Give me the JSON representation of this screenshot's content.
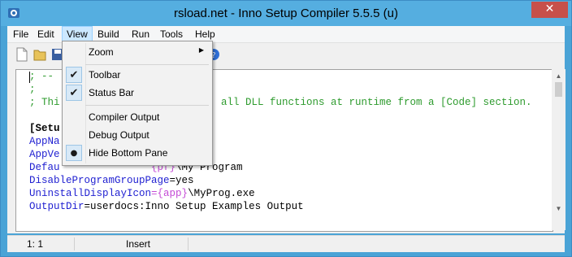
{
  "window": {
    "title": "rsload.net - Inno Setup Compiler 5.5.5 (u)",
    "close_glyph": "✕"
  },
  "menu": [
    "File",
    "Edit",
    "View",
    "Build",
    "Run",
    "Tools",
    "Help"
  ],
  "view_menu": {
    "zoom": "Zoom",
    "toolbar": "Toolbar",
    "status_bar": "Status Bar",
    "compiler_output": "Compiler Output",
    "debug_output": "Debug Output",
    "hide_bottom_pane": "Hide Bottom Pane",
    "check_glyph": "✔",
    "radio_glyph": "●",
    "submenu_glyph": "▶"
  },
  "editor": {
    "lines": [
      {
        "comment": "; --"
      },
      {
        "comment": ";"
      },
      {
        "comment_pre": "; Thi",
        "comment_post": "all DLL functions at runtime from a [Code] section."
      },
      {
        "section": "[Setu"
      },
      {
        "key": "AppNa"
      },
      {
        "key": "AppVe"
      },
      {
        "key_pre": "Defau",
        "const_part": "{pf}",
        "rest": "\\My Program"
      },
      {
        "key": "DisableProgramGroupPage",
        "eq": "=",
        "value": "yes"
      },
      {
        "key": "UninstallDisplayIcon",
        "eq": "=",
        "const_part": "{app}",
        "rest": "\\MyProg.exe"
      },
      {
        "key": "OutputDir",
        "eq": "=",
        "value": "userdocs:Inno Setup Examples Output"
      }
    ]
  },
  "status": {
    "position": "1:   1",
    "mode": "Insert"
  },
  "icons": [
    "new-file-icon",
    "open-folder-icon",
    "save-icon",
    "help-icon",
    "app-icon"
  ]
}
